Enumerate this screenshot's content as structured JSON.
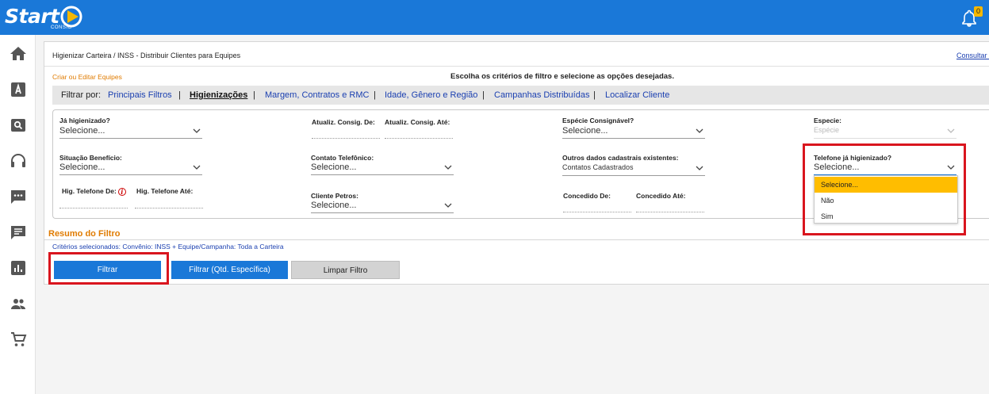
{
  "brand": {
    "name": "Start",
    "sub": "CONSIG"
  },
  "notifications": {
    "count": "0"
  },
  "sidebar": {
    "items": [
      {
        "icon": "home-icon"
      },
      {
        "icon": "font-icon"
      },
      {
        "icon": "search-card-icon"
      },
      {
        "icon": "headset-icon"
      },
      {
        "icon": "chat-dots-icon"
      },
      {
        "icon": "message-icon"
      },
      {
        "icon": "bar-chart-icon"
      },
      {
        "icon": "people-icon"
      },
      {
        "icon": "cart-icon"
      }
    ]
  },
  "page": {
    "breadcrumb": "Higienizar Carteira / INSS - Distribuir Clientes para Equipes",
    "consult_link": "Consultar C",
    "create_link": "Criar ou Editar Equipes",
    "instruction": "Escolha os critérios de filtro e selecione as opções desejadas."
  },
  "filter_bar": {
    "label": "Filtrar por:",
    "tabs": [
      {
        "label": "Principais Filtros",
        "active": false
      },
      {
        "label": "Higienizações",
        "active": true
      },
      {
        "label": "Margem, Contratos e RMC",
        "active": false
      },
      {
        "label": "Idade, Gênero e Região",
        "active": false
      },
      {
        "label": "Campanhas Distribuídas",
        "active": false
      },
      {
        "label": "Localizar Cliente",
        "active": false
      }
    ],
    "separator": "|"
  },
  "form": {
    "ja_higienizado": {
      "label": "Já higienizado?",
      "value": "Selecione..."
    },
    "atualiz_de": {
      "label": "Atualiz. Consig. De:",
      "value": ""
    },
    "atualiz_ate": {
      "label": "Atualiz. Consig. Até:",
      "value": ""
    },
    "especie_consignavel": {
      "label": "Espécie Consignável?",
      "value": "Selecione..."
    },
    "especie": {
      "label": "Especie:",
      "value": "Espécie"
    },
    "situacao_beneficio": {
      "label": "Situação Benefício:",
      "value": "Selecione..."
    },
    "contato_telefonico": {
      "label": "Contato Telefônico:",
      "value": "Selecione..."
    },
    "outros_dados": {
      "label": "Outros dados cadastrais existentes:",
      "value": "Contatos Cadastrados"
    },
    "telefone_higienizado": {
      "label": "Telefone já higienizado?",
      "value": "Selecione..."
    },
    "hig_tel_de": {
      "label": "Hig. Telefone De:",
      "value": ""
    },
    "hig_tel_ate": {
      "label": "Hig. Telefone Até:",
      "value": ""
    },
    "cliente_petros": {
      "label": "Cliente Petros:",
      "value": "Selecione..."
    },
    "concedido_de": {
      "label": "Concedido De:",
      "value": ""
    },
    "concedido_ate": {
      "label": "Concedido Até:",
      "value": ""
    }
  },
  "dropdown": {
    "options": [
      {
        "label": "Selecione...",
        "selected": true
      },
      {
        "label": "Não",
        "selected": false
      },
      {
        "label": "Sim",
        "selected": false
      }
    ]
  },
  "summary": {
    "title": "Resumo do Filtro",
    "criteria": "Critérios selecionados: Convênio: INSS + Equipe/Campanha: Toda a Carteira"
  },
  "buttons": {
    "filter": "Filtrar",
    "filter_specific": "Filtrar (Qtd. Específica)",
    "clear": "Limpar Filtro"
  },
  "colors": {
    "primary": "#1a78d8",
    "accent_orange": "#e07b00",
    "link_blue": "#1a3fb0",
    "highlight": "#ffbd00",
    "annotation_red": "#d9151e"
  }
}
